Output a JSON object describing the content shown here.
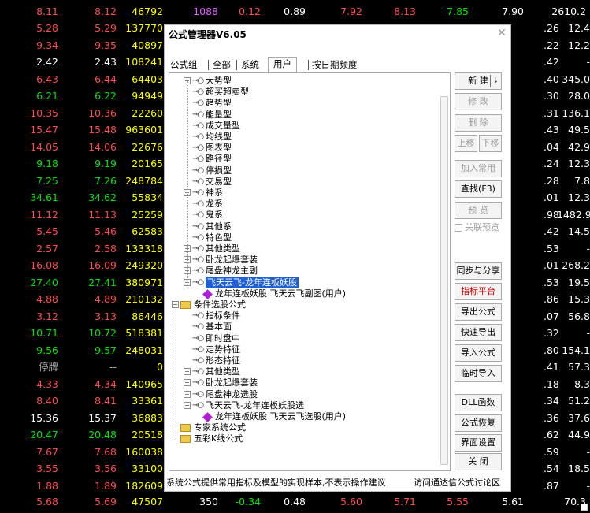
{
  "stock_table": {
    "first_row": {
      "a": "8.11",
      "b": "8.12",
      "c": "46792",
      "d": "1088",
      "e": "0.12",
      "f": "0.89",
      "g": "7.92",
      "h": "8.13",
      "i": "7.85",
      "j": "7.90",
      "k": "2610.2"
    },
    "rows": [
      {
        "p1": "5.28",
        "p2": "5.29",
        "vol": "137770",
        "c7": ".26",
        "c8": "12.4",
        "color": "up"
      },
      {
        "p1": "9.34",
        "p2": "9.35",
        "vol": "40897",
        "c7": ".22",
        "c8": "12.2",
        "color": "up"
      },
      {
        "p1": "2.42",
        "p2": "2.43",
        "vol": "108241",
        "c7": ".42",
        "c8": "-",
        "color": "wh"
      },
      {
        "p1": "6.43",
        "p2": "6.44",
        "vol": "64403",
        "c7": ".40",
        "c8": "345.0",
        "color": "up"
      },
      {
        "p1": "6.21",
        "p2": "6.22",
        "vol": "94949",
        "c7": ".30",
        "c8": "28.0",
        "color": "dn"
      },
      {
        "p1": "10.35",
        "p2": "10.36",
        "vol": "22260",
        "c7": ".31",
        "c8": "136.1",
        "color": "up"
      },
      {
        "p1": "15.47",
        "p2": "15.48",
        "vol": "963601",
        "c7": ".43",
        "c8": "49.5",
        "color": "up"
      },
      {
        "p1": "14.05",
        "p2": "14.06",
        "vol": "22676",
        "c7": ".04",
        "c8": "42.9",
        "color": "up"
      },
      {
        "p1": "9.18",
        "p2": "9.19",
        "vol": "20165",
        "c7": ".24",
        "c8": "12.3",
        "color": "dn"
      },
      {
        "p1": "7.25",
        "p2": "7.26",
        "vol": "248784",
        "c7": ".28",
        "c8": "7.8",
        "color": "dn"
      },
      {
        "p1": "34.61",
        "p2": "34.62",
        "vol": "55834",
        "c7": ".01",
        "c8": "12.3",
        "color": "dn"
      },
      {
        "p1": "11.12",
        "p2": "11.13",
        "vol": "25259",
        "c7": ".98",
        "c8": "1482.9",
        "color": "up"
      },
      {
        "p1": "5.45",
        "p2": "5.46",
        "vol": "62583",
        "c7": ".42",
        "c8": "14.5",
        "color": "up"
      },
      {
        "p1": "2.57",
        "p2": "2.58",
        "vol": "133318",
        "c7": ".53",
        "c8": "-",
        "color": "up"
      },
      {
        "p1": "16.08",
        "p2": "16.09",
        "vol": "249320",
        "c7": ".01",
        "c8": "268.2",
        "color": "up"
      },
      {
        "p1": "27.40",
        "p2": "27.41",
        "vol": "380971",
        "c7": ".53",
        "c8": "19.5",
        "color": "dn"
      },
      {
        "p1": "4.88",
        "p2": "4.89",
        "vol": "210132",
        "c7": ".86",
        "c8": "15.3",
        "color": "up"
      },
      {
        "p1": "3.12",
        "p2": "3.13",
        "vol": "86446",
        "c7": ".07",
        "c8": "56.8",
        "color": "up"
      },
      {
        "p1": "10.71",
        "p2": "10.72",
        "vol": "518381",
        "c7": ".32",
        "c8": "-",
        "color": "dn"
      },
      {
        "p1": "9.56",
        "p2": "9.57",
        "vol": "248031",
        "c7": ".80",
        "c8": "154.1",
        "color": "dn"
      },
      {
        "p1": "停牌",
        "p2": "--",
        "vol": "0",
        "c7": ".41",
        "c8": "57.3",
        "color": "gy"
      },
      {
        "p1": "4.33",
        "p2": "4.34",
        "vol": "140965",
        "c7": ".18",
        "c8": "8.3",
        "color": "up"
      },
      {
        "p1": "8.40",
        "p2": "8.41",
        "vol": "33361",
        "c7": ".34",
        "c8": "51.2",
        "color": "up"
      },
      {
        "p1": "15.36",
        "p2": "15.37",
        "vol": "36883",
        "c7": ".36",
        "c8": "37.6",
        "color": "wh"
      },
      {
        "p1": "20.47",
        "p2": "20.48",
        "vol": "20518",
        "c7": ".62",
        "c8": "44.9",
        "color": "dn"
      },
      {
        "p1": "7.67",
        "p2": "7.68",
        "vol": "160038",
        "c7": ".59",
        "c8": "-",
        "color": "up"
      },
      {
        "p1": "3.55",
        "p2": "3.56",
        "vol": "33100",
        "c7": ".54",
        "c8": "18.5",
        "color": "up"
      },
      {
        "p1": "1.88",
        "p2": "1.89",
        "vol": "182609",
        "c7": ".87",
        "c8": "-",
        "color": "up"
      }
    ],
    "last_row": {
      "a": "5.68",
      "b": "5.69",
      "c": "47507",
      "d": "350",
      "e": "-0.34",
      "f": "0.48",
      "g": "5.60",
      "h": "5.71",
      "i": "5.55",
      "j": "5.61",
      "k": "70.3"
    }
  },
  "dialog": {
    "title": "公式管理器V6.05",
    "close_icon": "close-icon",
    "tabs": [
      "公式组",
      "全部",
      "系统",
      "用户",
      "按日期频度"
    ],
    "active_tab": "用户",
    "tree": [
      {
        "label": "大势型",
        "kind": "expand"
      },
      {
        "label": "超买超卖型",
        "kind": "leaf"
      },
      {
        "label": "趋势型",
        "kind": "leaf"
      },
      {
        "label": "能量型",
        "kind": "leaf"
      },
      {
        "label": "成交量型",
        "kind": "leaf"
      },
      {
        "label": "均线型",
        "kind": "leaf"
      },
      {
        "label": "图表型",
        "kind": "leaf"
      },
      {
        "label": "路径型",
        "kind": "leaf"
      },
      {
        "label": "停损型",
        "kind": "leaf"
      },
      {
        "label": "交易型",
        "kind": "leaf"
      },
      {
        "label": "神系",
        "kind": "expand"
      },
      {
        "label": "龙系",
        "kind": "leaf"
      },
      {
        "label": "鬼系",
        "kind": "leaf"
      },
      {
        "label": "其他系",
        "kind": "leaf"
      },
      {
        "label": "特色型",
        "kind": "leaf"
      },
      {
        "label": "其他类型",
        "kind": "expand"
      },
      {
        "label": "卧龙起爆套装",
        "kind": "expand"
      },
      {
        "label": "尾盘神龙主副",
        "kind": "expand"
      },
      {
        "label": "飞天云飞-龙年连板妖股",
        "kind": "open-selected"
      },
      {
        "label": "龙年连板妖股   飞天云飞副图(用户)",
        "kind": "formula"
      },
      {
        "label": "条件选股公式",
        "kind": "folder-open"
      },
      {
        "label": "指标条件",
        "kind": "leaf"
      },
      {
        "label": "基本面",
        "kind": "leaf"
      },
      {
        "label": "即时盘中",
        "kind": "leaf"
      },
      {
        "label": "走势特征",
        "kind": "leaf"
      },
      {
        "label": "形态特征",
        "kind": "leaf"
      },
      {
        "label": "其他类型",
        "kind": "expand"
      },
      {
        "label": "卧龙起爆套装",
        "kind": "expand"
      },
      {
        "label": "尾盘神龙选股",
        "kind": "expand"
      },
      {
        "label": "飞天云飞-龙年连板妖股选",
        "kind": "open"
      },
      {
        "label": "龙年连板妖股   飞天云飞选股(用户)",
        "kind": "formula"
      },
      {
        "label": "专家系统公式",
        "kind": "folder"
      },
      {
        "label": "五彩K线公式",
        "kind": "folder"
      }
    ],
    "buttons": {
      "new": "新  建",
      "edit": "修  改",
      "delete": "删  除",
      "move_up": "上移",
      "move_down": "下移",
      "add_common": "加入常用",
      "find": "查找(F3)",
      "preview": "预  览",
      "linked_preview": "关联预览",
      "sync_share": "同步与分享",
      "indicator_platform": "指标平台",
      "export": "导出公式",
      "quick_export": "快速导出",
      "import": "导入公式",
      "temp_import": "临时导入",
      "dll": "DLL函数",
      "restore": "公式恢复",
      "ui_settings": "界面设置",
      "close": "关  闭"
    },
    "footer_note": "系统公式提供常用指标及模型的实现样本,不表示操作建议",
    "footer_link": "访问通达信公式讨论区"
  }
}
